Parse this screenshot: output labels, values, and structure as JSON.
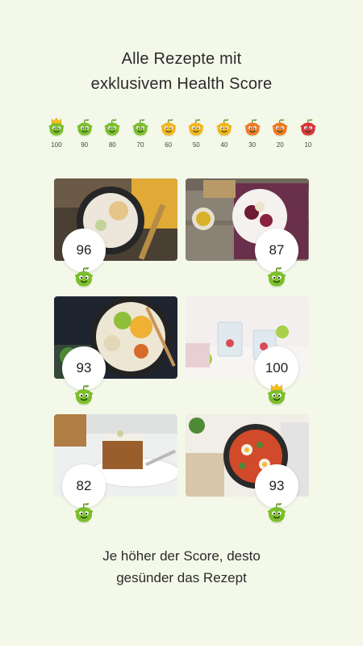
{
  "headline": {
    "line1": "Alle Rezepte mit",
    "line2": "exklusivem Health Score"
  },
  "scale": [
    {
      "score": "100",
      "color": "#7cbe2c",
      "crown": true
    },
    {
      "score": "90",
      "color": "#7cbe2c",
      "crown": false
    },
    {
      "score": "80",
      "color": "#7cbe2c",
      "crown": false
    },
    {
      "score": "70",
      "color": "#7cbe2c",
      "crown": false
    },
    {
      "score": "60",
      "color": "#f3b51f",
      "crown": false
    },
    {
      "score": "50",
      "color": "#f3b51f",
      "crown": false
    },
    {
      "score": "40",
      "color": "#f3b51f",
      "crown": false
    },
    {
      "score": "30",
      "color": "#ee7a24",
      "crown": false
    },
    {
      "score": "20",
      "color": "#ee7a24",
      "crown": false
    },
    {
      "score": "10",
      "color": "#d8353a",
      "crown": false
    }
  ],
  "recipes": [
    {
      "score": "96",
      "dish": "rice-porridge-bowl",
      "crown": false,
      "mascot_color": "#7cbe2c"
    },
    {
      "score": "87",
      "dish": "beetroot-salad-plate",
      "crown": false,
      "mascot_color": "#7cbe2c"
    },
    {
      "score": "93",
      "dish": "noodle-buddha-bowl",
      "crown": false,
      "mascot_color": "#7cbe2c"
    },
    {
      "score": "100",
      "dish": "infused-water-drinks",
      "crown": true,
      "mascot_color": "#7cbe2c"
    },
    {
      "score": "82",
      "dish": "carrot-cake-slice",
      "crown": false,
      "mascot_color": "#7cbe2c"
    },
    {
      "score": "93",
      "dish": "shakshuka-pan",
      "crown": false,
      "mascot_color": "#7cbe2c"
    }
  ],
  "footer": {
    "line1": "Je höher der Score, desto",
    "line2": "gesünder das Rezept"
  }
}
